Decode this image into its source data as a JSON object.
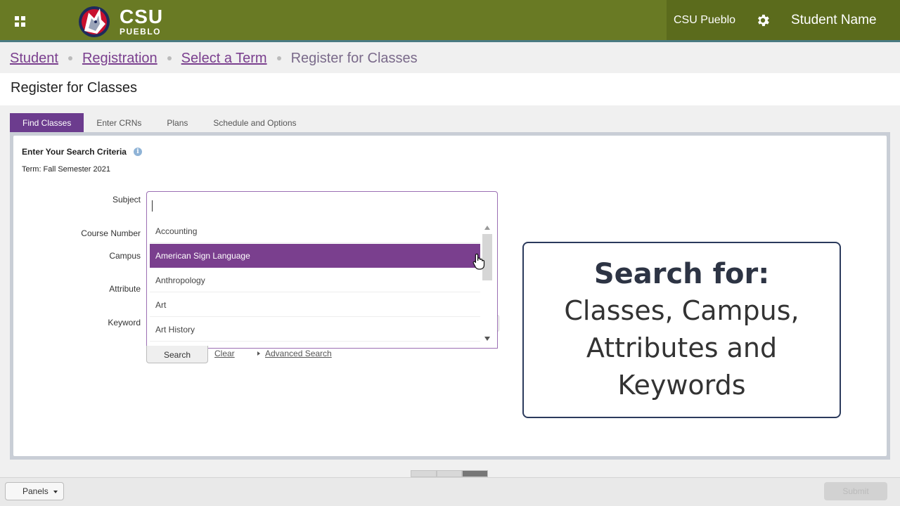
{
  "header": {
    "logo_main": "CSU",
    "logo_sub": "PUEBLO",
    "campus": "CSU Pueblo",
    "user": "Student Name",
    "colors": {
      "bar": "#697a24",
      "right_block": "#5b6b1c",
      "accent_purple": "#6c3c8e"
    }
  },
  "breadcrumb": {
    "items": [
      "Student",
      "Registration",
      "Select a Term"
    ],
    "current": "Register for Classes"
  },
  "page": {
    "title": "Register for Classes"
  },
  "tabs": [
    "Find Classes",
    "Enter CRNs",
    "Plans",
    "Schedule and Options"
  ],
  "active_tab": "Find Classes",
  "form": {
    "heading": "Enter Your Search Criteria",
    "term": "Term: Fall Semester 2021",
    "labels": {
      "subject": "Subject",
      "course_number": "Course Number",
      "campus": "Campus",
      "attribute": "Attribute",
      "keyword": "Keyword"
    },
    "subject_value": "",
    "dropdown_options": [
      "Accounting",
      "American Sign Language",
      "Anthropology",
      "Art",
      "Art History"
    ],
    "selected_option": "American Sign Language",
    "search_label": "Search",
    "clear_label": "Clear",
    "advanced_label": "Advanced Search"
  },
  "callout": {
    "heading": "Search for:",
    "lines": [
      "Classes, Campus,",
      "Attributes and",
      "Keywords"
    ]
  },
  "footer": {
    "panels_label": "Panels",
    "submit_label": "Submit"
  }
}
